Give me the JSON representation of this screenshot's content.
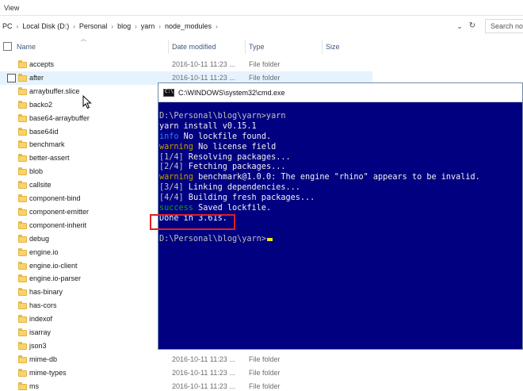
{
  "explorer": {
    "ribbon_tab": "View",
    "breadcrumb": [
      "PC",
      "Local Disk (D:)",
      "Personal",
      "blog",
      "yarn",
      "node_modules"
    ],
    "search_placeholder": "Search no",
    "columns": {
      "name": "Name",
      "date": "Date modified",
      "type": "Type",
      "size": "Size"
    },
    "files": [
      {
        "name": "accepts",
        "date": "2016-10-11 11:23 ...",
        "type": "File folder"
      },
      {
        "name": "after",
        "date": "2016-10-11 11:23 ...",
        "type": "File folder"
      },
      {
        "name": "arraybuffer.slice"
      },
      {
        "name": "backo2"
      },
      {
        "name": "base64-arraybuffer"
      },
      {
        "name": "base64id"
      },
      {
        "name": "benchmark"
      },
      {
        "name": "better-assert"
      },
      {
        "name": "blob"
      },
      {
        "name": "callsite"
      },
      {
        "name": "component-bind"
      },
      {
        "name": "component-emitter"
      },
      {
        "name": "component-inherit"
      },
      {
        "name": "debug"
      },
      {
        "name": "engine.io"
      },
      {
        "name": "engine.io-client"
      },
      {
        "name": "engine.io-parser"
      },
      {
        "name": "has-binary"
      },
      {
        "name": "has-cors"
      },
      {
        "name": "indexof"
      },
      {
        "name": "isarray"
      },
      {
        "name": "json3"
      },
      {
        "name": "mime-db",
        "date": "2016-10-11 11:23 ...",
        "type": "File folder"
      },
      {
        "name": "mime-types",
        "date": "2016-10-11 11:23 ...",
        "type": "File folder"
      },
      {
        "name": "ms",
        "date": "2016-10-11 11:23 ...",
        "type": "File folder"
      }
    ],
    "folder_color": "#f9d36b"
  },
  "cmd": {
    "title": "C:\\WINDOWS\\system32\\cmd.exe",
    "icon_label": "C:\\",
    "background": "#000080",
    "lines": [
      [
        {
          "text": "D:\\Personal\\blog\\yarn>yarn",
          "color": "grey"
        }
      ],
      [
        {
          "text": "yarn install v0.15.1",
          "color": "white"
        }
      ],
      [
        {
          "text": "info",
          "color": "blue"
        },
        {
          "text": " No lockfile found.",
          "color": "white"
        }
      ],
      [
        {
          "text": "warning",
          "color": "yellow"
        },
        {
          "text": " No license field",
          "color": "white"
        }
      ],
      [
        {
          "text": "[1/4]",
          "color": "grey"
        },
        {
          "text": " Resolving packages...",
          "color": "white"
        }
      ],
      [
        {
          "text": "[2/4]",
          "color": "grey"
        },
        {
          "text": " Fetching packages...",
          "color": "white"
        }
      ],
      [
        {
          "text": "warning",
          "color": "yellow"
        },
        {
          "text": " benchmark@1.0.0: The engine \"rhino\" appears to be invalid.",
          "color": "white"
        }
      ],
      [
        {
          "text": "[3/4]",
          "color": "grey"
        },
        {
          "text": " Linking dependencies...",
          "color": "white"
        }
      ],
      [
        {
          "text": "[4/4]",
          "color": "grey"
        },
        {
          "text": " Building fresh packages...",
          "color": "white"
        }
      ],
      [
        {
          "text": "success",
          "color": "green"
        },
        {
          "text": " Saved lockfile.",
          "color": "white"
        }
      ],
      [
        {
          "text": "Done in 3.61s.",
          "color": "white"
        }
      ],
      [],
      [
        {
          "text": "D:\\Personal\\blog\\yarn>",
          "color": "grey"
        }
      ]
    ],
    "highlight_color": "#e02020"
  }
}
